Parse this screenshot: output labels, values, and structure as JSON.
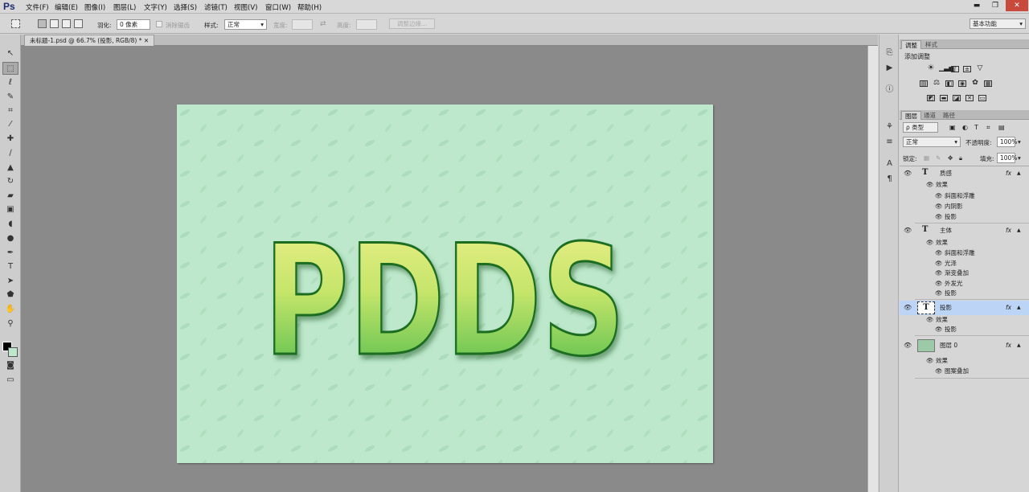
{
  "app": {
    "logo": "Ps"
  },
  "menu": [
    "文件(F)",
    "编辑(E)",
    "图像(I)",
    "图层(L)",
    "文字(Y)",
    "选择(S)",
    "滤镜(T)",
    "视图(V)",
    "窗口(W)",
    "帮助(H)"
  ],
  "window_buttons": {
    "minimize": "▬",
    "restore": "❐",
    "close": "✕"
  },
  "options": {
    "feather_label": "羽化:",
    "feather_value": "0 像素",
    "antialias_label": "消除锯齿",
    "style_label": "样式:",
    "style_value": "正常",
    "width_label": "宽度:",
    "height_label": "高度:",
    "refine_label": "调整边缘...",
    "workspace_value": "基本功能"
  },
  "document": {
    "tab_title": "未标题-1.psd @ 66.7% (投影, RGB/8) *"
  },
  "canvas_text": "PDDS",
  "colors": {
    "canvas_bg": "#bde8cc",
    "text_top": "#eef08a",
    "text_bottom": "#45b84a",
    "text_edge": "#1f6d22",
    "selected_layer": "#bcd5f7"
  },
  "adjust_panel": {
    "tabs": [
      "调整",
      "样式"
    ],
    "title": "添加调整"
  },
  "layers_panel": {
    "tabs": [
      "图层",
      "通道",
      "路径"
    ],
    "filter_value": "ρ 类型",
    "blend_mode": "正常",
    "opacity_label": "不透明度:",
    "opacity_value": "100%",
    "lock_label": "锁定:",
    "fill_label": "填充:",
    "fill_value": "100%",
    "fx_label": "fx",
    "effects_label": "效果",
    "layers": [
      {
        "name": "质感",
        "effects": [
          "斜面和浮雕",
          "内阴影",
          "投影"
        ]
      },
      {
        "name": "主体",
        "effects": [
          "斜面和浮雕",
          "光泽",
          "渐变叠加",
          "外发光",
          "投影"
        ]
      },
      {
        "name": "投影",
        "effects": [
          "投影"
        ],
        "selected": true
      },
      {
        "name": "图层 0",
        "effects": [
          "图案叠加"
        ]
      }
    ]
  },
  "tool_icons": [
    "move-icon",
    "marquee-icon",
    "lasso-icon",
    "quick-select-icon",
    "crop-icon",
    "eyedropper-icon",
    "healing-icon",
    "brush-icon",
    "clone-stamp-icon",
    "history-brush-icon",
    "eraser-icon",
    "gradient-icon",
    "blur-icon",
    "dodge-icon",
    "pen-icon",
    "type-icon",
    "path-select-icon",
    "shape-icon",
    "hand-icon",
    "zoom-icon"
  ]
}
